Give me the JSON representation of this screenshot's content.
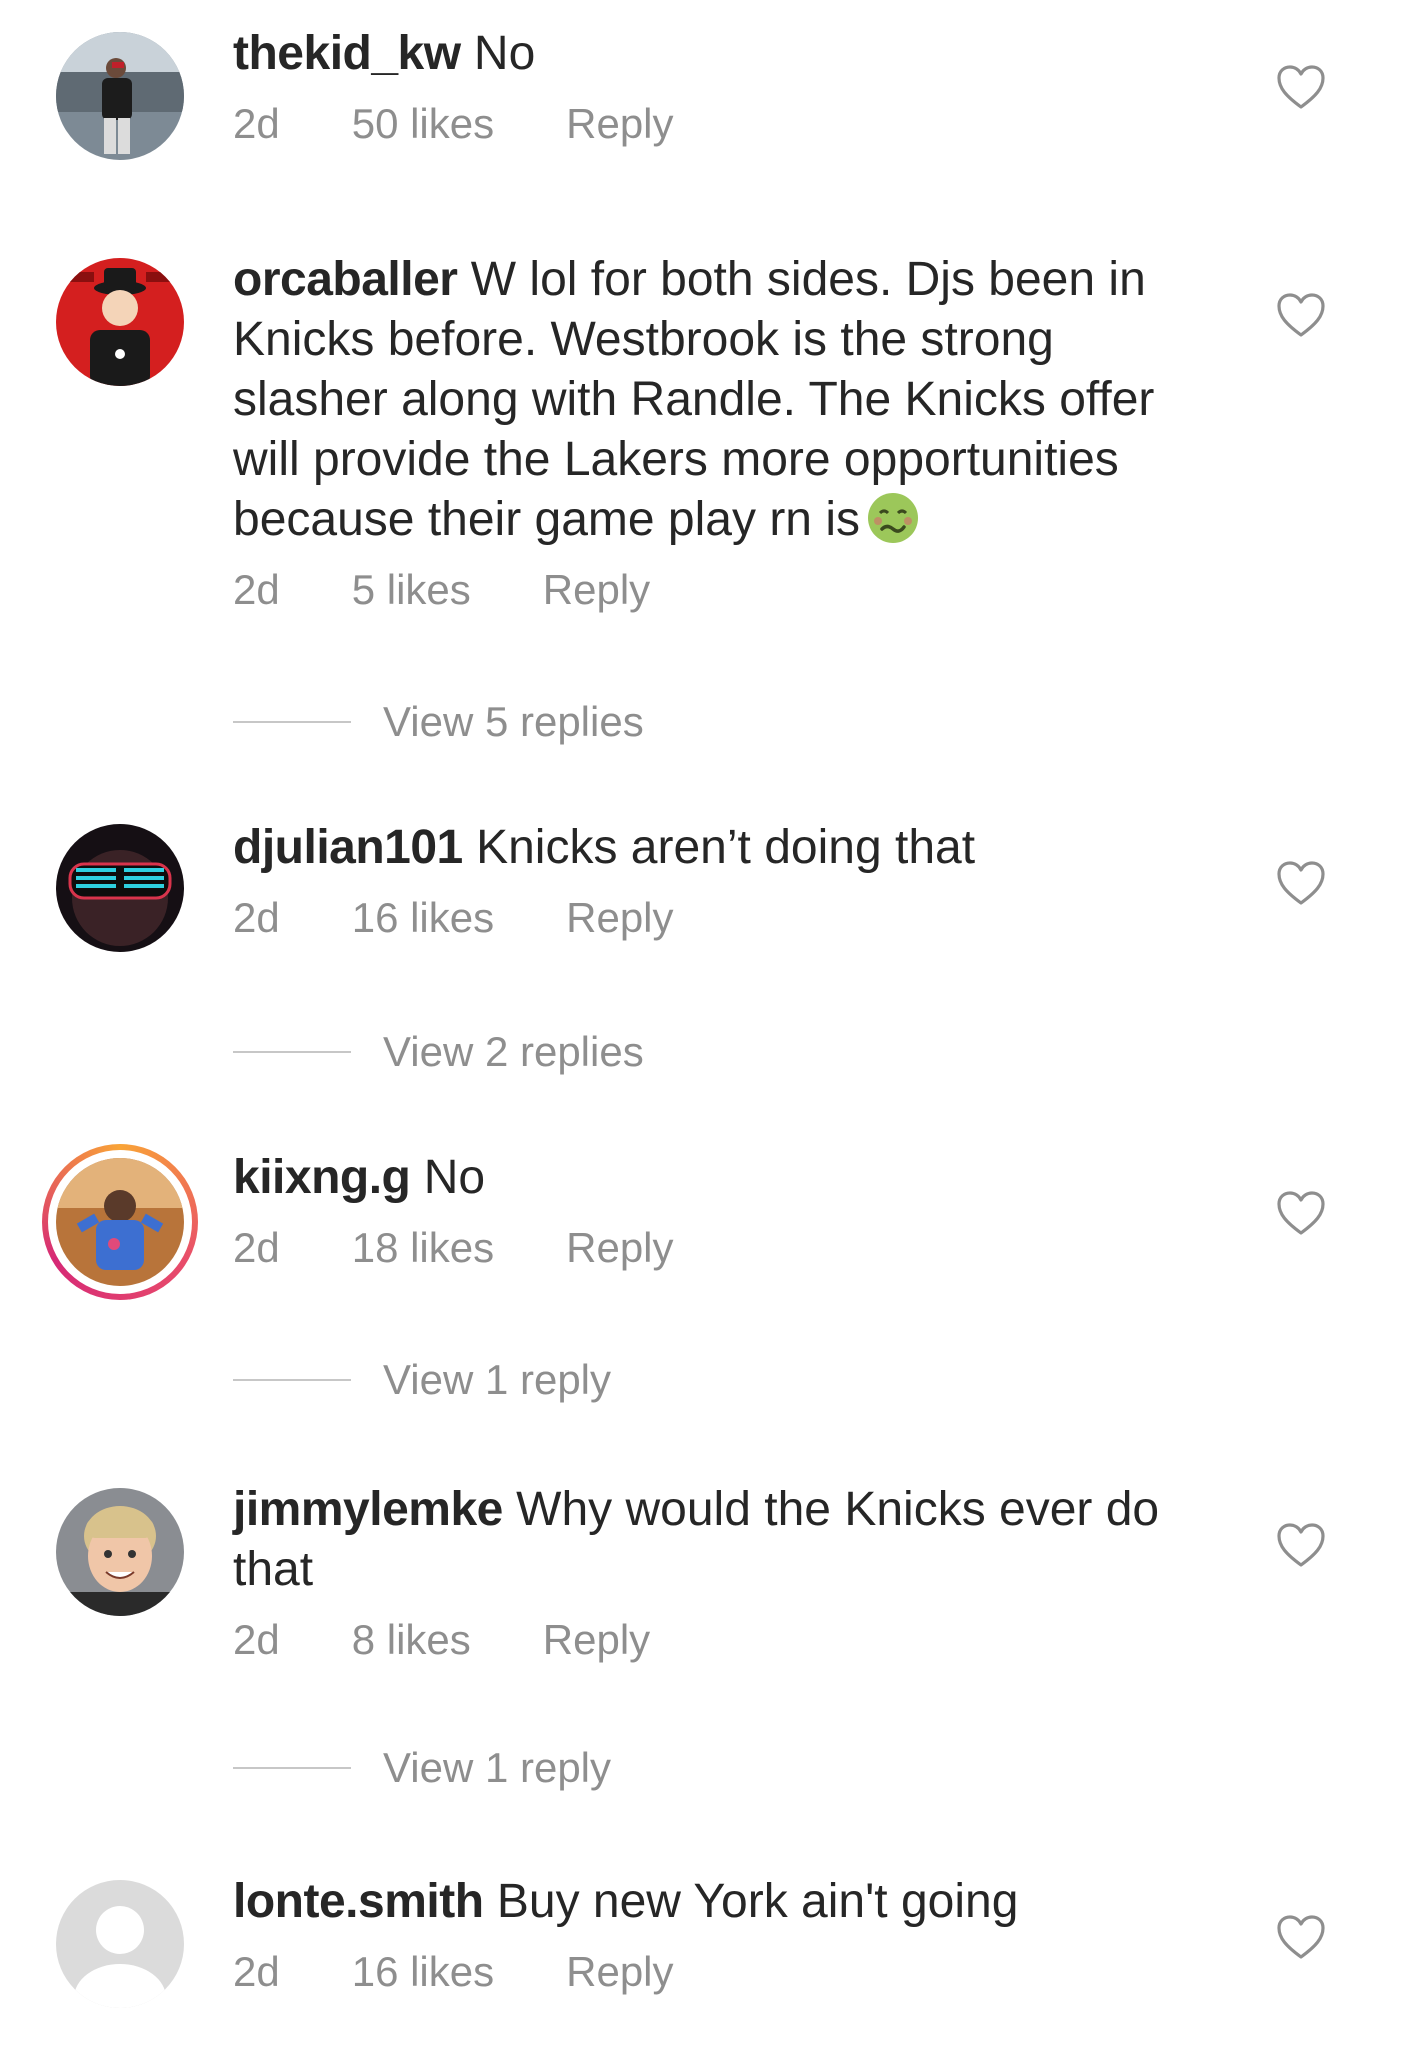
{
  "comments": [
    {
      "username": "thekid_kw",
      "text": " No",
      "time": "2d",
      "likes": "50 likes",
      "reply": "Reply",
      "view_replies": ""
    },
    {
      "username": "orcaballer",
      "text": " W lol for both sides. Djs been in Knicks before. Westbrook is the strong slasher along with Randle. The Knicks offer will provide the Lakers more opportunities because their game play rn is",
      "emoji": "nauseated-face-emoji",
      "time": "2d",
      "likes": "5 likes",
      "reply": "Reply",
      "view_replies": "View 5 replies"
    },
    {
      "username": "djulian101",
      "text": " Knicks aren’t doing that",
      "time": "2d",
      "likes": "16 likes",
      "reply": "Reply",
      "view_replies": "View 2 replies"
    },
    {
      "username": "kiixng.g",
      "text": " No",
      "time": "2d",
      "likes": "18 likes",
      "reply": "Reply",
      "view_replies": "View 1 reply",
      "story_ring": true
    },
    {
      "username": "jimmylemke",
      "text": " Why would the Knicks ever do that",
      "time": "2d",
      "likes": "8 likes",
      "reply": "Reply",
      "view_replies": "View 1 reply"
    },
    {
      "username": "lonte.smith",
      "text": " Buy new York ain't going",
      "time": "2d",
      "likes": "16 likes",
      "reply": "Reply",
      "view_replies": ""
    }
  ],
  "icons": {
    "like": "heart-outline-icon",
    "default_avatar": "default-avatar-icon"
  },
  "colors": {
    "text": "#262626",
    "secondary": "#8e8e8e",
    "divider": "#c7c7c7"
  }
}
